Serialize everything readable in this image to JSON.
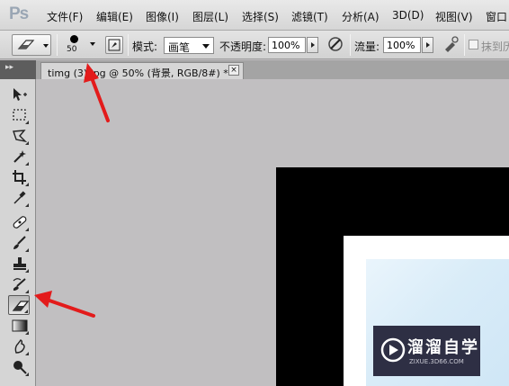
{
  "app": {
    "logo": "Ps"
  },
  "menu": [
    "文件(F)",
    "编辑(E)",
    "图像(I)",
    "图层(L)",
    "选择(S)",
    "滤镜(T)",
    "分析(A)",
    "3D(D)",
    "视图(V)",
    "窗口"
  ],
  "options": {
    "brush_size": "50",
    "mode_label": "模式:",
    "mode_value": "画笔",
    "opacity_label": "不透明度:",
    "opacity_value": "100%",
    "flow_label": "流量:",
    "flow_value": "100%",
    "erase_history_label": "抹到历"
  },
  "toolbox": {
    "header": "▸▸"
  },
  "document": {
    "tab_title": "timg (3).jpg @ 50% (背景, RGB/8#) *",
    "close_glyph": "×"
  },
  "watermark": {
    "title": "溜溜自学",
    "subtitle": "ZIXUE.3D66.COM"
  },
  "colors": {
    "annotation_arrow": "#e31b1b",
    "canvas_bg": "#c1bfc1",
    "watermark_bg": "#2e2f44"
  }
}
